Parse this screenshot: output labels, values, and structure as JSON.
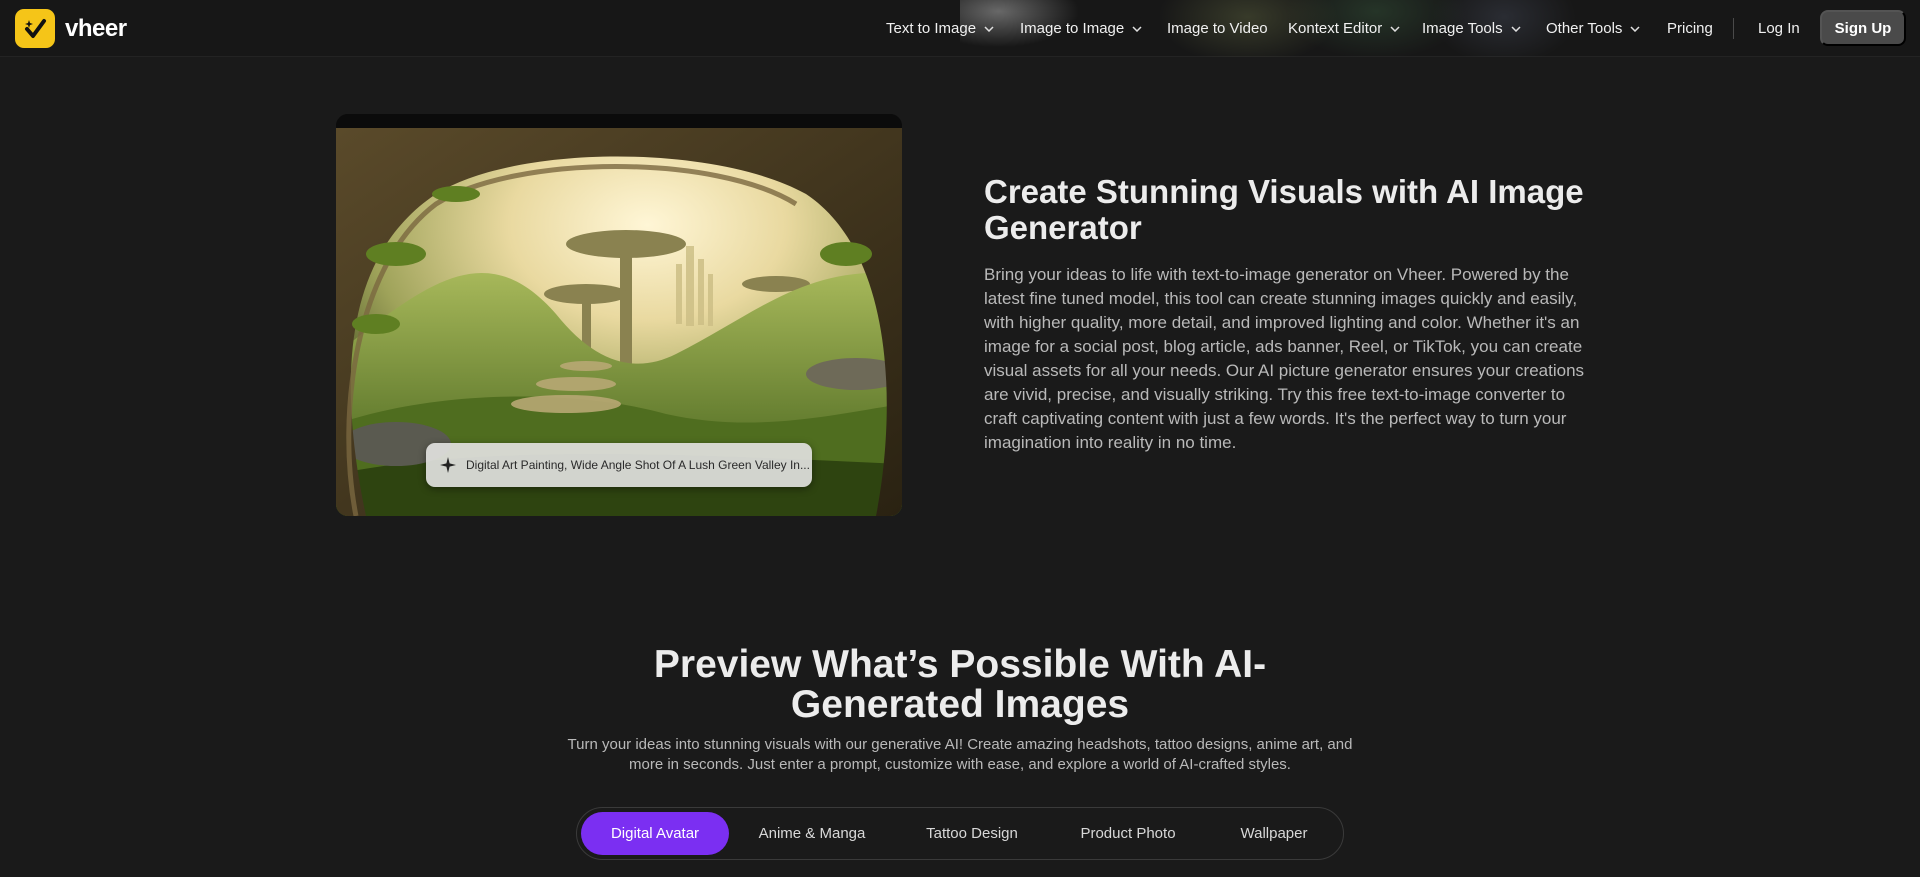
{
  "header": {
    "brand": "vheer",
    "nav": [
      {
        "label": "Text to Image",
        "has_dropdown": true
      },
      {
        "label": "Image to Image",
        "has_dropdown": true
      },
      {
        "label": "Image to Video",
        "has_dropdown": false
      },
      {
        "label": "Kontext Editor",
        "has_dropdown": true
      },
      {
        "label": "Image Tools",
        "has_dropdown": true
      },
      {
        "label": "Other Tools",
        "has_dropdown": true
      },
      {
        "label": "Pricing",
        "has_dropdown": false
      }
    ],
    "login_label": "Log In",
    "signup_label": "Sign Up"
  },
  "hero": {
    "title": "Create Stunning Visuals with AI Image Generator",
    "description": "Bring your ideas to life with text-to-image generator on Vheer. Powered by the latest fine tuned model, this tool can create stunning images quickly and easily, with higher quality, more detail, and improved lighting and color. Whether it's an image for a social post, blog article, ads banner, Reel, or TikTok, you can create visual assets for all your needs. Our AI picture generator ensures your creations are vivid, precise, and visually striking. Try this free text-to-image converter to craft captivating content with just a few words. It's the perfect way to turn your imagination into reality in no time.",
    "prompt": "Digital Art Painting, Wide Angle Shot Of A Lush Green Valley In...",
    "prompt_icon": "sparkle-icon"
  },
  "preview": {
    "title": "Preview What’s Possible With AI-Generated Images",
    "description": "Turn your ideas into stunning visuals with our generative AI! Create amazing headshots, tattoo designs, anime art, and more in seconds. Just enter a prompt, customize with ease, and explore a world of AI-crafted styles.",
    "tabs": [
      "Digital Avatar",
      "Anime & Manga",
      "Tattoo Design",
      "Product Photo",
      "Wallpaper"
    ],
    "active_tab": "Digital Avatar"
  },
  "colors": {
    "background": "#1a1a1a",
    "brand_yellow": "#f5c518",
    "accent_purple": "#7b2ff2",
    "signup_button": "#4a4a4a"
  }
}
